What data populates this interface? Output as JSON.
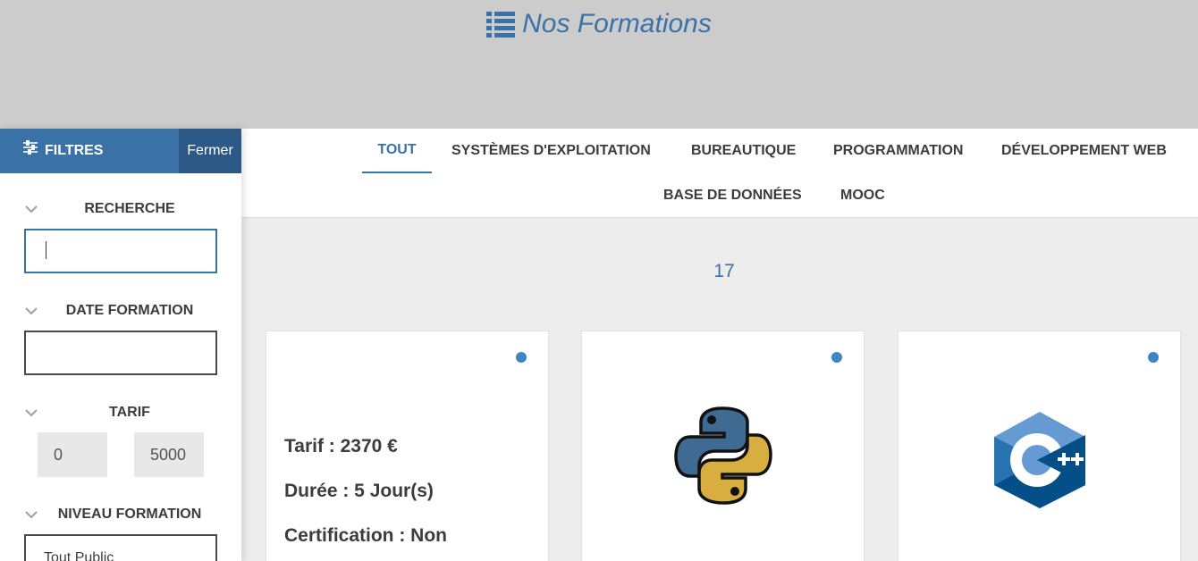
{
  "header": {
    "title": "Nos Formations",
    "icon": "list-icon"
  },
  "tabs": [
    {
      "label": "TOUT",
      "active": true
    },
    {
      "label": "SYSTÈMES D'EXPLOITATION",
      "active": false
    },
    {
      "label": "BUREAUTIQUE",
      "active": false
    },
    {
      "label": "PROGRAMMATION",
      "active": false
    },
    {
      "label": "DÉVELOPPEMENT WEB",
      "active": false
    },
    {
      "label": "BASE DE DONNÉES",
      "active": false
    },
    {
      "label": "MOOC",
      "active": false
    }
  ],
  "results": {
    "count": "17"
  },
  "sidebar": {
    "title": "FILTRES",
    "title_icon": "sliders-icon",
    "close_label": "Fermer",
    "sections": {
      "search": {
        "label": "RECHERCHE",
        "value": ""
      },
      "date": {
        "label": "DATE FORMATION",
        "value": ""
      },
      "tarif": {
        "label": "TARIF",
        "min": "0",
        "max": "5000"
      },
      "niveau": {
        "label": "NIVEAU FORMATION",
        "value": "Tout Public"
      }
    }
  },
  "cards": [
    {
      "logo": "",
      "tarif": "Tarif : 2370 €",
      "duree": "Durée : 5 Jour(s)",
      "certification": "Certification : Non"
    },
    {
      "logo": "python-logo-icon"
    },
    {
      "logo": "cpp-logo-icon"
    }
  ],
  "colors": {
    "accent": "#3a72a8",
    "accent_dark": "#2c5985",
    "dot": "#3d86c6",
    "python_blue": "#3f6a92",
    "python_yellow": "#d8ae41",
    "cpp_blue": "#659ad2",
    "cpp_dark": "#044f88"
  }
}
